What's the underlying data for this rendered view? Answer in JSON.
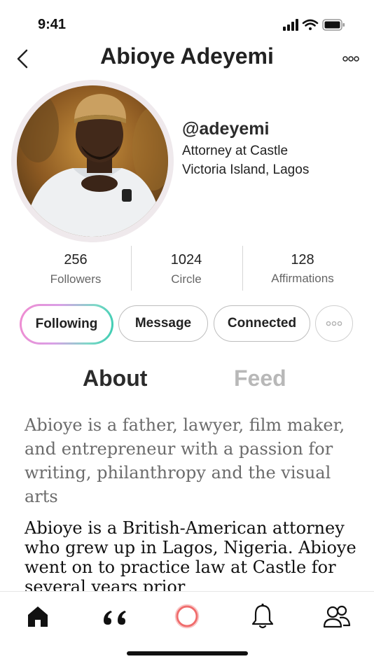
{
  "status_bar": {
    "time": "9:41",
    "icons": [
      "signal-icon",
      "wifi-icon",
      "battery-icon"
    ]
  },
  "header": {
    "title": "Abioye Adeyemi",
    "back_icon": "chevron-left-icon",
    "more_icon": "more-horizontal-icon"
  },
  "profile": {
    "handle": "@adeyemi",
    "job": "Attorney at Castle",
    "location": "Victoria Island, Lagos"
  },
  "stats": [
    {
      "value": "256",
      "label": "Followers"
    },
    {
      "value": "1024",
      "label": "Circle"
    },
    {
      "value": "128",
      "label": "Affirmations"
    }
  ],
  "actions": {
    "following": "Following",
    "message": "Message",
    "connected": "Connected",
    "more_icon": "more-horizontal-icon"
  },
  "tabs": {
    "about": "About",
    "feed": "Feed",
    "active": "about"
  },
  "about": {
    "bio_short": "Abioye is a father, lawyer, film maker, and entrepreneur with a passion for writing, philanthropy and the visual arts",
    "bio_long": "Abioye is a British-American attorney who  grew up in Lagos, Nigeria. Abioye went on to practice law at Castle for several years prior"
  },
  "nav": [
    "home-icon",
    "quote-icon",
    "circle-icon",
    "bell-icon",
    "people-icon"
  ],
  "colors": {
    "gradient_pink": "#f08bd0",
    "gradient_teal": "#37cbb0",
    "nav_circle": "#f06d6d",
    "muted_tab": "#b8b8b8"
  }
}
